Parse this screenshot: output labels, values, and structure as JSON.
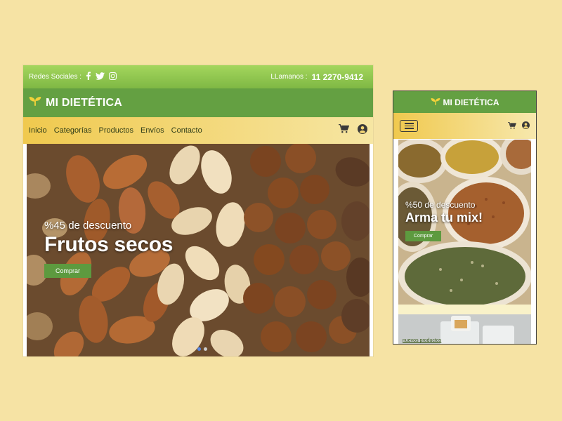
{
  "desktop": {
    "topbar": {
      "social_label": "Redes Sociales :",
      "call_label": "LLamanos :",
      "phone": "11 2270-9412"
    },
    "brand": {
      "name": "MI DIETÉTICA"
    },
    "nav": {
      "links": [
        "Inicio",
        "Categorías",
        "Productos",
        "Envíos",
        "Contacto"
      ]
    },
    "hero": {
      "kicker": "%45 de descuento",
      "title": "Frutos secos",
      "button": "Comprar"
    }
  },
  "mobile": {
    "brand": {
      "name": "MI DIETÉTICA"
    },
    "hero": {
      "kicker": "%50 de descuento",
      "title": "Arma tu mix!",
      "button": "Comprar"
    },
    "products_label": "nuevos productos"
  },
  "colors": {
    "background": "#f6e3a4",
    "brand_green": "#64a042",
    "topbar_green": "#8cc64e",
    "nav_gold": "#f0c94e",
    "button_green": "#5d9a3f",
    "active_dot": "#5a87e4"
  },
  "icons": [
    "sprout-icon",
    "facebook-icon",
    "twitter-icon",
    "instagram-icon",
    "cart-icon",
    "user-icon",
    "menu-icon"
  ]
}
